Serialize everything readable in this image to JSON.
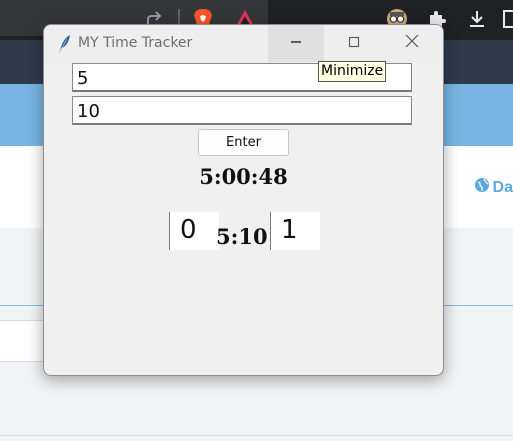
{
  "background": {
    "link_text": "Da"
  },
  "window": {
    "title": "MY Time Tracker",
    "controls": {
      "minimize_icon": "minimize-icon",
      "maximize_icon": "maximize-icon",
      "close_icon": "close-icon"
    }
  },
  "form": {
    "field1_value": "5",
    "field2_value": "10",
    "enter_label": "Enter"
  },
  "display": {
    "clock": "5:00:48",
    "left_box_value": "0",
    "middle_time": "5:10",
    "right_box_value": "1"
  },
  "tooltip": {
    "text": "Minimize"
  },
  "colors": {
    "banner": "#78b5e3",
    "link": "#5aa9df",
    "window_bg": "#f0f0f0",
    "tooltip_bg": "#ffffe1"
  }
}
